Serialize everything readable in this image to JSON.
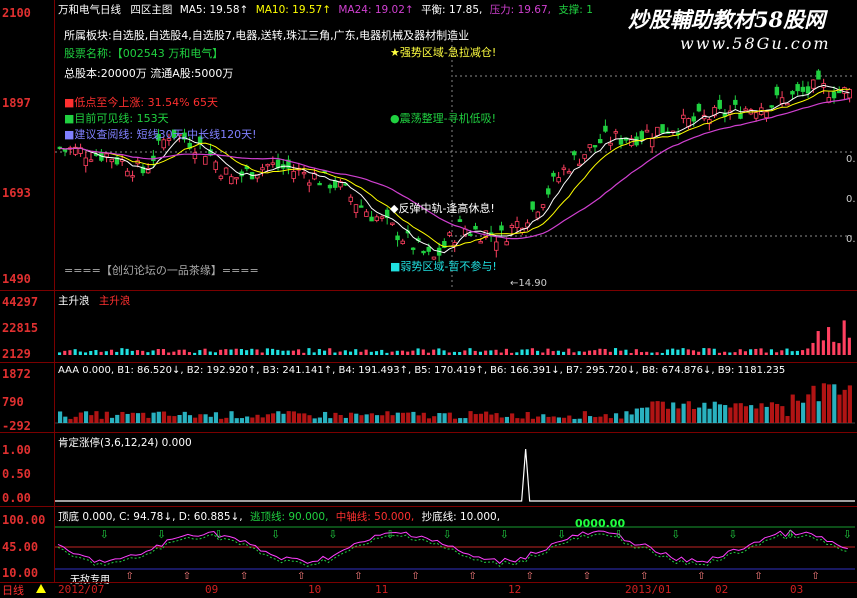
{
  "header": {
    "stock_label": "万和电气日线",
    "chart_label": "四区主图",
    "ma5": "MA5: 19.58↑",
    "ma10": "MA10: 19.57↑",
    "ma24": "MA24: 19.02↑",
    "balance": "平衡: 17.85,",
    "pressure": "压力: 19.67,",
    "support": "支撑: 1"
  },
  "watermark": {
    "title": "炒股輔助教材58股网",
    "url": "www.58Gu.com"
  },
  "info": {
    "sector": "所属板块:自选股,自选股4,自选股7,电器,送转,珠江三角,广东,电器机械及器材制造业",
    "name": "股票名称:【002543 万和电气】",
    "shares": "总股本:20000万   流通A股:5000万",
    "low_point": "■低点至今上涨: 31.54% 65天",
    "visible": "■目前可见线: 153天",
    "suggest": "■建议查阅线: 短线30天,中长线120天!",
    "forum": "====【创幻论坛の一品茶缘】===="
  },
  "zones": {
    "strong": "★强势区域-急拉减仓!",
    "shock": "●震荡整理-寻机低吸!",
    "rebound": "◆反弹中轨-逢高休息!",
    "weak": "■弱势区域-暂不参与!"
  },
  "low_mark": "←14.90",
  "price_axis": [
    "2100",
    "1897",
    "1693",
    "1490"
  ],
  "right_ticks": [
    "0.",
    "0.",
    "0."
  ],
  "volume": {
    "label": "主升浪",
    "label2": "主升浪",
    "axis": [
      "44297",
      "22815",
      "2129"
    ]
  },
  "aaa": {
    "title": "AAA 0.000, B1: 86.520↓, B2: 192.920↑, B3: 241.141↑, B4: 191.493↑, B5: 170.419↑, B6: 166.391↓, B7: 295.720↓, B8: 674.876↓, B9: 1181.235",
    "axis": [
      "1872",
      "790",
      "-292"
    ]
  },
  "limit": {
    "title": "肯定涨停(3,6,12,24) 0.000",
    "axis": [
      "1.00",
      "0.50",
      "0.00"
    ]
  },
  "bottom": {
    "title_a": "顶底 0.000,  C: 94.78↓,  D: 60.885↓,",
    "escape": "逃顶线: 90.000,",
    "mid": "中轴线: 50.000,",
    "bottom_line": "抄底线: 10.000,",
    "marker": "0000.00",
    "axis": [
      "100.00",
      "45.00",
      "10.00"
    ],
    "tag": "无敌专用"
  },
  "footer": {
    "period": "日线",
    "dates": [
      "2012/07",
      "09",
      "10",
      "11",
      "12",
      "2013/01",
      "02",
      "03"
    ]
  },
  "colors": {
    "up": "#ff4060",
    "down": "#20d040",
    "ma5": "#ffffff",
    "ma24": "#d040d0",
    "grid": "#7a0000",
    "axis_text": "#e03030",
    "yellow": "#ffff00"
  }
}
